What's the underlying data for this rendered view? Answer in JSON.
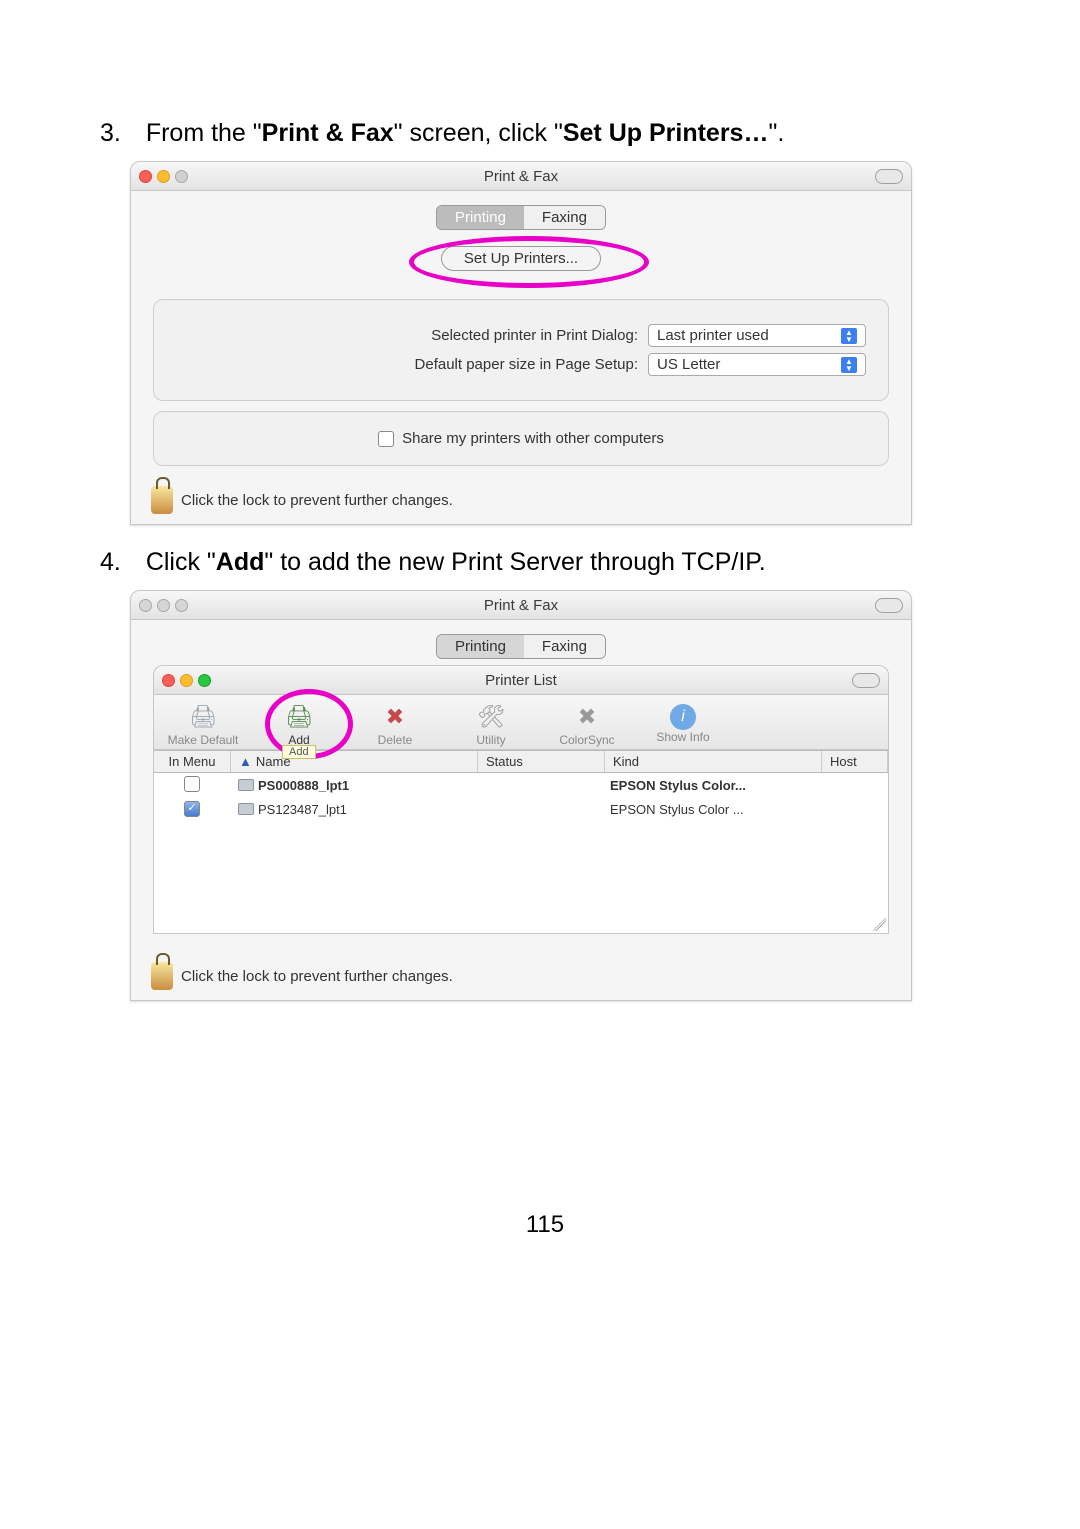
{
  "page_number": "115",
  "step3": {
    "num": "3.",
    "t1": "From the \"",
    "b1": "Print & Fax",
    "t2": "\" screen, click \"",
    "b2": "Set Up Printers…",
    "t3": "\"."
  },
  "step4": {
    "num": "4.",
    "t1": "Click \"",
    "b1": "Add",
    "t2": "\" to add the new Print Server through TCP/IP."
  },
  "win1": {
    "title": "Print & Fax",
    "tab_printing": "Printing",
    "tab_faxing": "Faxing",
    "setup_btn": "Set Up Printers...",
    "sel_lbl": "Selected printer in Print Dialog:",
    "sel_val": "Last printer used",
    "paper_lbl": "Default paper size in Page Setup:",
    "paper_val": "US Letter",
    "share_lbl": "Share my printers with other computers",
    "lock_lbl": "Click the lock to prevent further changes."
  },
  "win2": {
    "title": "Print & Fax",
    "tab_printing": "Printing",
    "tab_faxing": "Faxing",
    "inner_title": "Printer List",
    "tb_make": "Make Default",
    "tb_add": "Add",
    "tb_del": "Delete",
    "tb_util": "Utility",
    "tb_cs": "ColorSync",
    "tb_info": "Show Info",
    "tooltip_add": "Add",
    "h_menu": "In Menu",
    "h_name": "Name",
    "h_status": "Status",
    "h_kind": "Kind",
    "h_host": "Host",
    "rows": [
      {
        "name": "PS000888_lpt1",
        "kind": "EPSON Stylus Color..."
      },
      {
        "name": "PS123487_lpt1",
        "kind": "EPSON Stylus Color ..."
      }
    ],
    "lock_lbl": "Click the lock to prevent further changes."
  }
}
